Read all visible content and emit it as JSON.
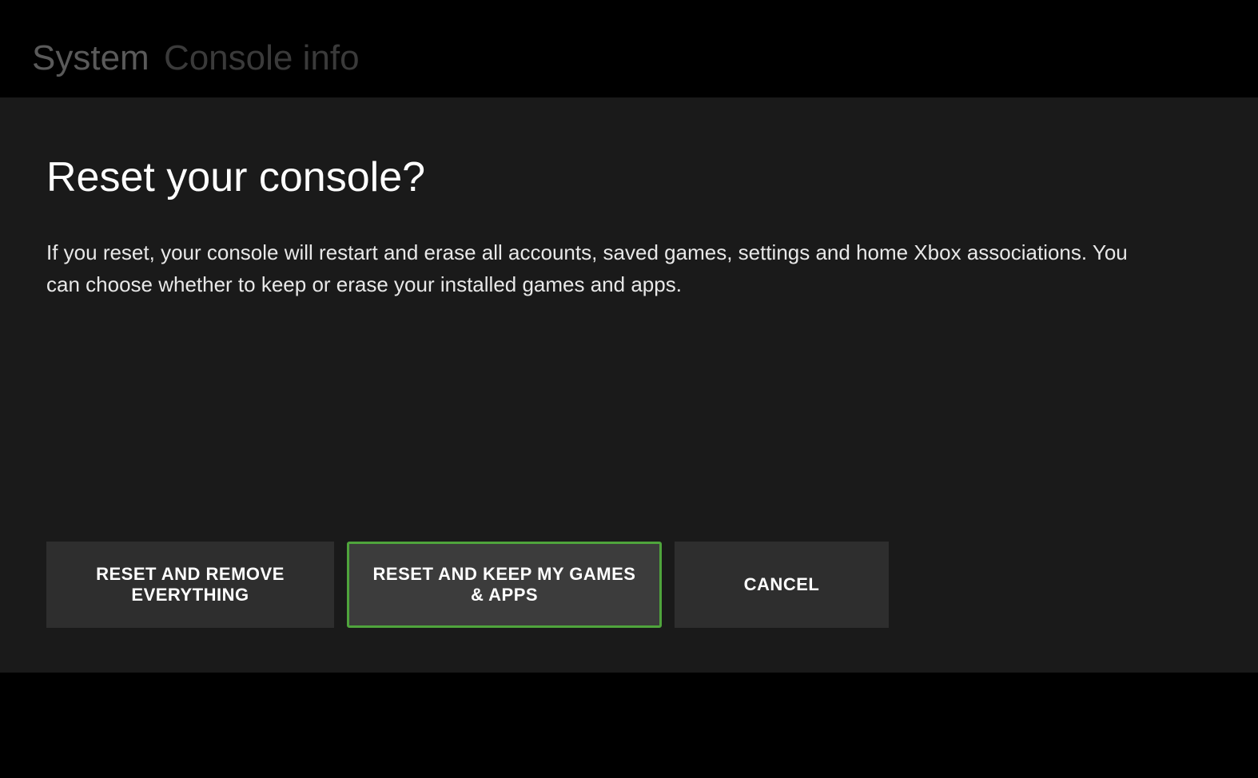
{
  "header": {
    "breadcrumb_main": "System",
    "breadcrumb_sub": "Console info"
  },
  "main": {
    "title": "Reset your console?",
    "description": "If you reset, your console will restart and erase all accounts, saved games, settings and home Xbox associations. You can choose whether to keep or erase your installed games and apps."
  },
  "buttons": {
    "reset_all": "RESET AND REMOVE EVERYTHING",
    "reset_keep": "RESET AND KEEP MY GAMES & APPS",
    "cancel": "CANCEL"
  }
}
